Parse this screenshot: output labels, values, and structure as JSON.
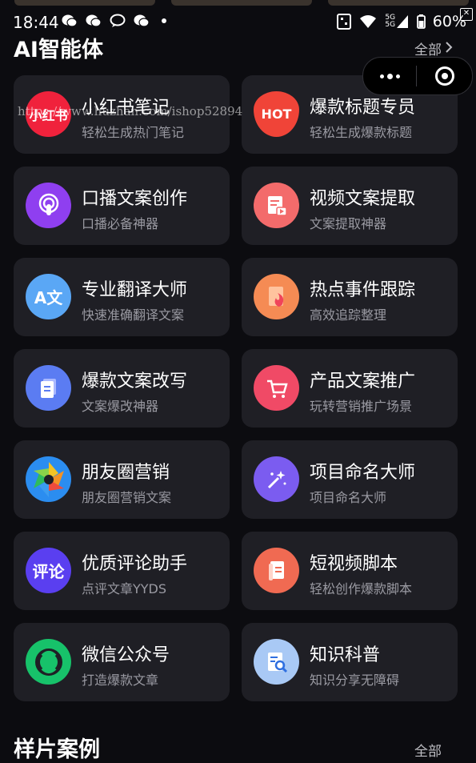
{
  "status_bar": {
    "time": "18:44",
    "battery": "60%",
    "network_label": "5G",
    "network_label_2": "5G"
  },
  "section": {
    "title": "AI智能体",
    "see_all": "全部"
  },
  "watermark": "https://www.huzhan.com/ishop52894",
  "cards": [
    {
      "title": "小红书笔记",
      "subtitle": "轻松生成热门笔记",
      "icon": "xiaohongshu-icon",
      "icon_text": "小红书",
      "color": "#f0223c"
    },
    {
      "title": "爆款标题专员",
      "subtitle": "轻松生成爆款标题",
      "icon": "hot-flame-icon",
      "icon_text": "HOT",
      "color": "#f04438"
    },
    {
      "title": "口播文案创作",
      "subtitle": "口播必备神器",
      "icon": "podcast-icon",
      "icon_text": "",
      "color": "#8f3ff0"
    },
    {
      "title": "视频文案提取",
      "subtitle": "文案提取神器",
      "icon": "video-document-icon",
      "icon_text": "",
      "color": "#f36b6b"
    },
    {
      "title": "专业翻译大师",
      "subtitle": "快速准确翻译文案",
      "icon": "translate-icon",
      "icon_text": "A文",
      "color": "#5aa7f5"
    },
    {
      "title": "热点事件跟踪",
      "subtitle": "高效追踪整理",
      "icon": "hot-event-icon",
      "icon_text": "",
      "color": "#f58b54"
    },
    {
      "title": "爆款文案改写",
      "subtitle": "文案爆改神器",
      "icon": "document-rewrite-icon",
      "icon_text": "",
      "color": "#5b7cf2"
    },
    {
      "title": "产品文案推广",
      "subtitle": "玩转营销推广场景",
      "icon": "shopping-cart-icon",
      "icon_text": "",
      "color": "#f04a66"
    },
    {
      "title": "朋友圈营销",
      "subtitle": "朋友圈营销文案",
      "icon": "moments-aperture-icon",
      "icon_text": "",
      "color": "#2b8df0"
    },
    {
      "title": "项目命名大师",
      "subtitle": "项目命名大师",
      "icon": "magic-wand-icon",
      "icon_text": "",
      "color": "#7b5cf0"
    },
    {
      "title": "优质评论助手",
      "subtitle": "点评文章YYDS",
      "icon": "comment-icon",
      "icon_text": "评论",
      "color": "#5a3ff0"
    },
    {
      "title": "短视频脚本",
      "subtitle": "轻松创作爆款脚本",
      "icon": "script-book-icon",
      "icon_text": "",
      "color": "#f06a52"
    },
    {
      "title": "微信公众号",
      "subtitle": "打造爆款文章",
      "icon": "wechat-official-icon",
      "icon_text": "",
      "color": "#17c26a"
    },
    {
      "title": "知识科普",
      "subtitle": "知识分享无障碍",
      "icon": "knowledge-search-icon",
      "icon_text": "",
      "color": "#a9c9f5"
    }
  ],
  "bottom_section": {
    "title": "样片案例",
    "see_all": "全部"
  }
}
